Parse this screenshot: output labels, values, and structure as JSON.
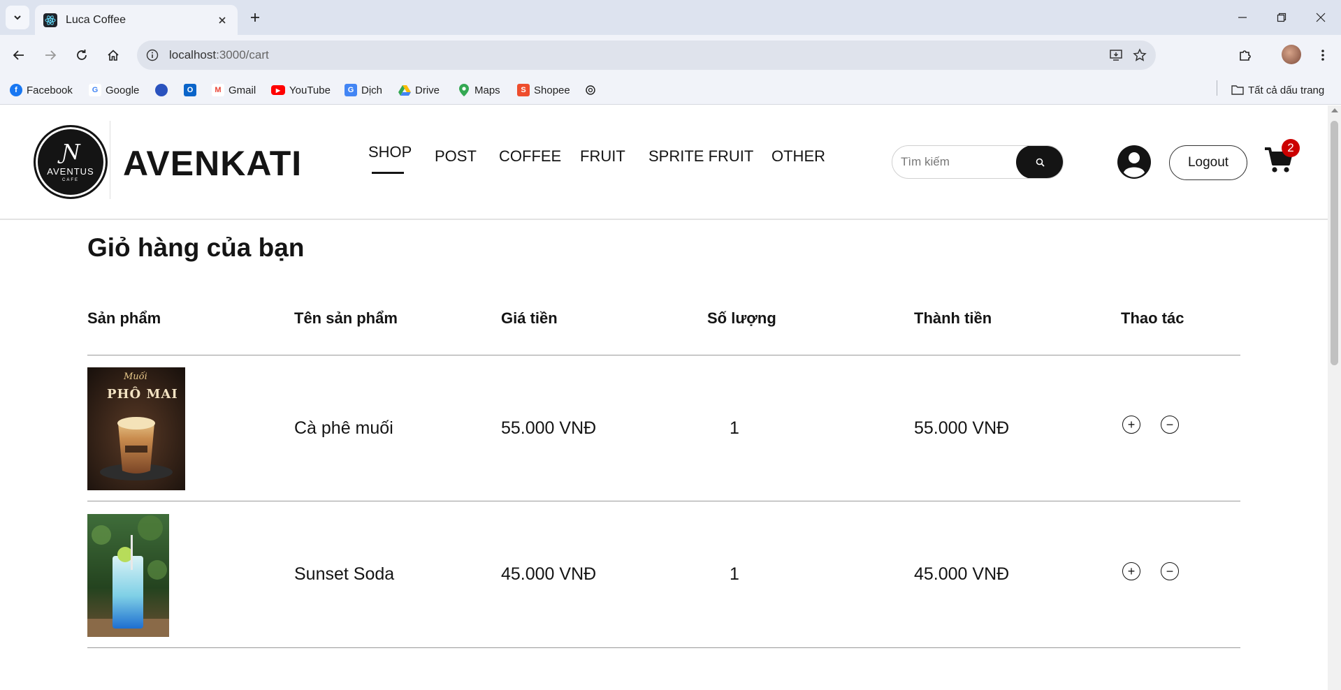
{
  "browser": {
    "tab_title": "Luca Coffee",
    "url_host": "localhost",
    "url_path": ":3000/cart",
    "bookmarks": [
      "Facebook",
      "Google",
      "",
      "",
      "Gmail",
      "YouTube",
      "Dịch",
      "Drive",
      "Maps",
      "Shopee",
      ""
    ],
    "all_bookmarks_label": "Tất cả dấu trang"
  },
  "header": {
    "logo_mark": "Ɲ",
    "logo_word": "AVENTUS",
    "logo_sub": "CAFE",
    "brand": "AVENKATI",
    "nav": [
      "SHOP",
      "POST",
      "COFFEE",
      "FRUIT",
      "SPRITE FRUIT",
      "OTHER"
    ],
    "search_placeholder": "Tìm kiếm",
    "logout_label": "Logout",
    "cart_count": "2"
  },
  "cart": {
    "title": "Giỏ hàng của bạn",
    "columns": [
      "Sản phẩm",
      "Tên sản phẩm",
      "Giá tiền",
      "Số lượng",
      "Thành tiền",
      "Thao tác"
    ],
    "items": [
      {
        "image_text_top": "Muối",
        "image_text_main": "PHÔ MAI",
        "name": "Cà phê muối",
        "price": "55.000 VNĐ",
        "qty": "1",
        "total": "55.000 VNĐ"
      },
      {
        "name": "Sunset Soda",
        "price": "45.000 VNĐ",
        "qty": "1",
        "total": "45.000 VNĐ"
      }
    ],
    "plus_symbol": "+",
    "minus_symbol": "−"
  },
  "colors": {
    "accent": "#141414",
    "badge": "#cc0000",
    "chrome": "#dde3ef"
  }
}
